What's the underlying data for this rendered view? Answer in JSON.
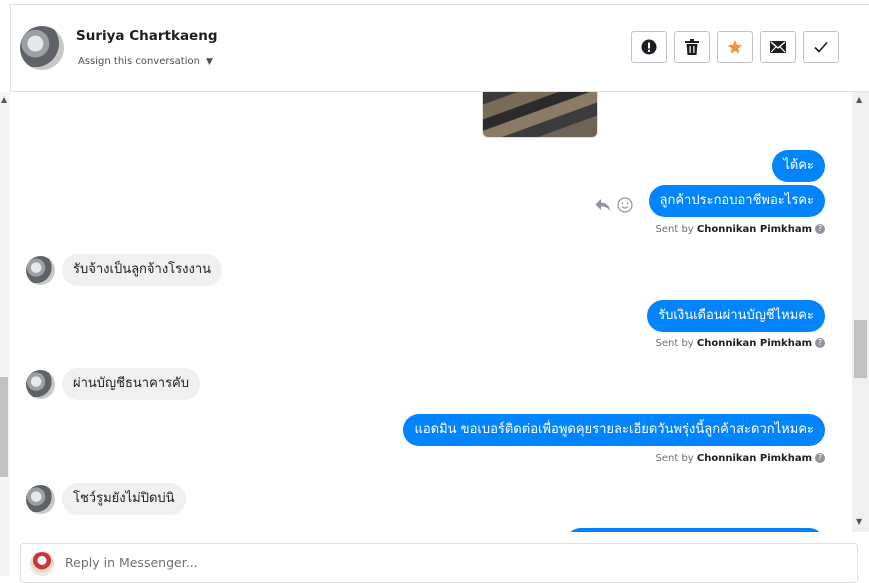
{
  "header": {
    "name": "Suriya Chartkaeng",
    "assign_label": "Assign this conversation"
  },
  "toolbar": {
    "buttons": [
      {
        "icon": "exclamation-icon"
      },
      {
        "icon": "trash-icon"
      },
      {
        "icon": "star-icon",
        "color": "#f7923b"
      },
      {
        "icon": "mail-icon"
      },
      {
        "icon": "check-icon"
      }
    ]
  },
  "messages": [
    {
      "direction": "out",
      "text": "ได้คะ"
    },
    {
      "direction": "out",
      "text": "ลูกค้าประกอบอาชีพอะไรคะ",
      "sent_by_prefix": "Sent by",
      "sent_by_name": "Chonnikan Pimkham"
    },
    {
      "direction": "in",
      "text": "รับจ้างเป็นลูกจ้างโรงงาน"
    },
    {
      "direction": "out",
      "text": "รับเงินเดือนผ่านบัญชีไหมคะ",
      "sent_by_prefix": "Sent by",
      "sent_by_name": "Chonnikan Pimkham"
    },
    {
      "direction": "in",
      "text": "ผ่านบัญชีธนาคารคับ"
    },
    {
      "direction": "out",
      "text": "แอดมิน ขอเบอร์ติดต่อเพื่อพูดคุยรายละเอียดวันพรุ่งนี้ลูกค้าสะดวกไหมคะ",
      "sent_by_prefix": "Sent by",
      "sent_by_name": "Chonnikan Pimkham"
    },
    {
      "direction": "in",
      "text": "โชว์รูมยังไม่ปิดบ่นิ"
    }
  ],
  "reply": {
    "placeholder": "Reply in Messenger..."
  },
  "colors": {
    "outgoing_bubble": "#0084ff",
    "incoming_bubble": "#f1f0f0",
    "star": "#f7923b"
  }
}
